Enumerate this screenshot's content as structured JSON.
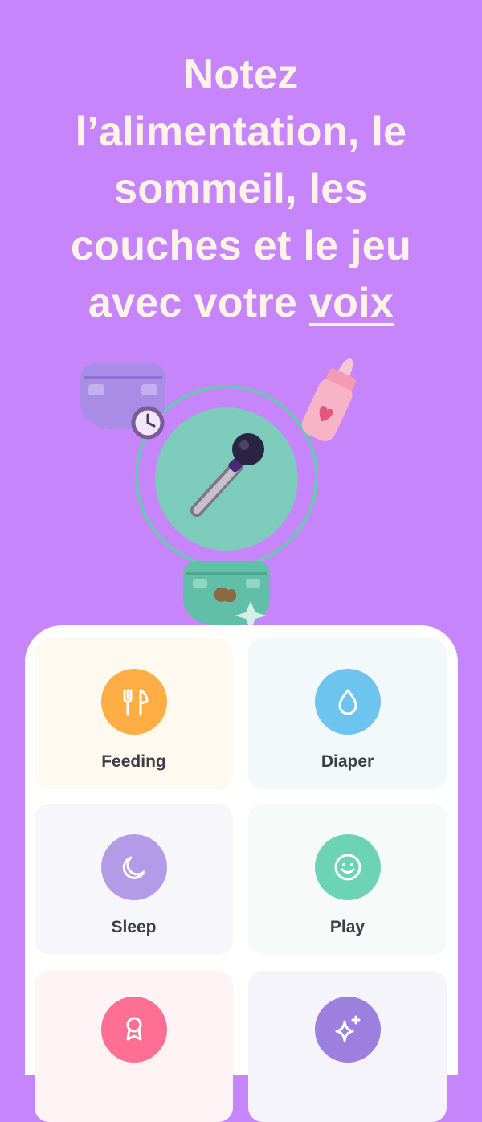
{
  "headline": {
    "line1": "Notez",
    "line2": "l’alimentation, le",
    "line3": "sommeil, les",
    "line4": "couches et le jeu",
    "line5_prefix": "avec votre ",
    "line5_underlined": "voix"
  },
  "tiles": [
    {
      "label": "Feeding",
      "icon": "fork-icon",
      "color": "#ffae45"
    },
    {
      "label": "Diaper",
      "icon": "drop-icon",
      "color": "#6cc4ef"
    },
    {
      "label": "Sleep",
      "icon": "moon-icon",
      "color": "#b49be8"
    },
    {
      "label": "Play",
      "icon": "smiley-icon",
      "color": "#6dd3b5"
    },
    {
      "label": "",
      "icon": "medal-icon",
      "color": "#ff6f94"
    },
    {
      "label": "",
      "icon": "sparkle-icon",
      "color": "#9d7fe0"
    }
  ],
  "colors": {
    "background": "#c685fb",
    "headline_text": "#fff3e8",
    "mic_circle": "#7ccbbb"
  }
}
